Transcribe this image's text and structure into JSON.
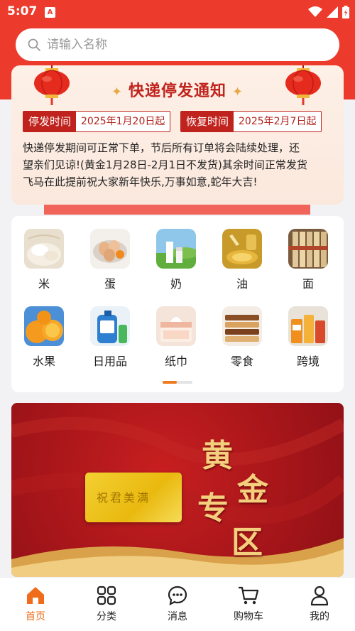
{
  "status_bar": {
    "time": "5:07",
    "app_badge": "A"
  },
  "search": {
    "placeholder": "请输入名称"
  },
  "notice": {
    "title": "快递停发通知",
    "stop_label": "停发时间",
    "stop_value": "2025年1月20日起",
    "resume_label": "恢复时间",
    "resume_value": "2025年2月7日起",
    "body_lines": [
      "快递停发期间可正常下单，节后所有订单将会陆续处理，还",
      "望亲们见谅!(黄金1月28日-2月1日不发货)其余时间正常发货",
      "飞马在此提前祝大家新年快乐,万事如意,蛇年大吉!"
    ]
  },
  "categories": [
    {
      "label": "米",
      "icon": "rice-icon"
    },
    {
      "label": "蛋",
      "icon": "egg-icon"
    },
    {
      "label": "奶",
      "icon": "milk-icon"
    },
    {
      "label": "油",
      "icon": "oil-icon"
    },
    {
      "label": "面",
      "icon": "noodle-icon"
    },
    {
      "label": "水果",
      "icon": "fruit-icon"
    },
    {
      "label": "日用品",
      "icon": "daily-goods-icon"
    },
    {
      "label": "纸巾",
      "icon": "tissue-icon"
    },
    {
      "label": "零食",
      "icon": "snack-icon"
    },
    {
      "label": "跨境",
      "icon": "cross-border-icon"
    }
  ],
  "carousel": {
    "pages": 2,
    "active_page": 1
  },
  "banner": {
    "card_text": "祝君美满",
    "chars": [
      "黄",
      "金",
      "专",
      "区"
    ]
  },
  "nav": {
    "items": [
      {
        "label": "首页",
        "icon": "home-icon",
        "active": true
      },
      {
        "label": "分类",
        "icon": "category-icon",
        "active": false
      },
      {
        "label": "消息",
        "icon": "message-icon",
        "active": false
      },
      {
        "label": "购物车",
        "icon": "cart-icon",
        "active": false
      },
      {
        "label": "我的",
        "icon": "user-icon",
        "active": false
      }
    ]
  },
  "colors": {
    "brand_red": "#ec3b2c",
    "accent_orange": "#ef6c1a",
    "notice_red": "#c0231d"
  }
}
